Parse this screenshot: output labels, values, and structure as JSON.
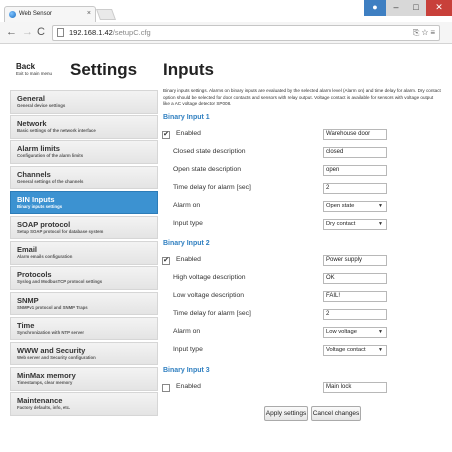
{
  "browser": {
    "tab_title": "Web Sensor",
    "tab_close": "×",
    "url_host": "192.168.1.42",
    "url_path": "/setupC.cfg",
    "url_icons": "⎘ ☆ ≡"
  },
  "sidebar": {
    "back_label": "Back",
    "back_sub": "Exit to main menu",
    "title": "Settings",
    "items": [
      {
        "label": "General",
        "sub": "General device settings"
      },
      {
        "label": "Network",
        "sub": "Basic settings of the network interface"
      },
      {
        "label": "Alarm limits",
        "sub": "Configuration of the alarm limits"
      },
      {
        "label": "Channels",
        "sub": "General settings of the channels"
      },
      {
        "label": "BIN Inputs",
        "sub": "Binary inputs settings"
      },
      {
        "label": "SOAP protocol",
        "sub": "Setup SOAP protocol for database system"
      },
      {
        "label": "Email",
        "sub": "Alarm emails configuration"
      },
      {
        "label": "Protocols",
        "sub": "Syslog and ModbusTCP protocol settings"
      },
      {
        "label": "SNMP",
        "sub": "SNMPv1 protocol and SNMP Traps"
      },
      {
        "label": "Time",
        "sub": "Synchronization with NTP server"
      },
      {
        "label": "WWW and Security",
        "sub": "Web server and Security configuration"
      },
      {
        "label": "MinMax memory",
        "sub": "Timestamps, clear memory"
      },
      {
        "label": "Maintenance",
        "sub": "Factory defaults, info, etc."
      }
    ]
  },
  "main": {
    "title": "Inputs",
    "intro": "Binary inputs settings. Alarms on binary inputs are evaluated by the selected alarm level (Alarm on) and time delay for alarm. Dry contact option should be selected for door contacts and sensors with relay output. Voltage contact is available for sensors with voltage output like a AC voltage detector SP008.",
    "input1": {
      "heading": "Binary Input 1",
      "enabled_label": "Enabled",
      "enabled_check": "✔",
      "name": "Warehouse door",
      "closed_label": "Closed state description",
      "closed_value": "closed",
      "open_label": "Open state description",
      "open_value": "open",
      "delay_label": "Time delay for alarm [sec]",
      "delay_value": "2",
      "alarm_label": "Alarm on",
      "alarm_value": "Open state",
      "type_label": "Input type",
      "type_value": "Dry contact"
    },
    "input2": {
      "heading": "Binary Input 2",
      "enabled_label": "Enabled",
      "enabled_check": "✔",
      "name": "Power supply",
      "high_label": "High voltage description",
      "high_value": "OK",
      "low_label": "Low voltage description",
      "low_value": "FAIL!",
      "delay_label": "Time delay for alarm [sec]",
      "delay_value": "2",
      "alarm_label": "Alarm on",
      "alarm_value": "Low voltage",
      "type_label": "Input type",
      "type_value": "Voltage contact"
    },
    "input3": {
      "heading": "Binary Input 3",
      "enabled_label": "Enabled",
      "enabled_check": "",
      "name": "Main lock"
    },
    "apply_label": "Apply settings",
    "cancel_label": "Cancel changes"
  }
}
